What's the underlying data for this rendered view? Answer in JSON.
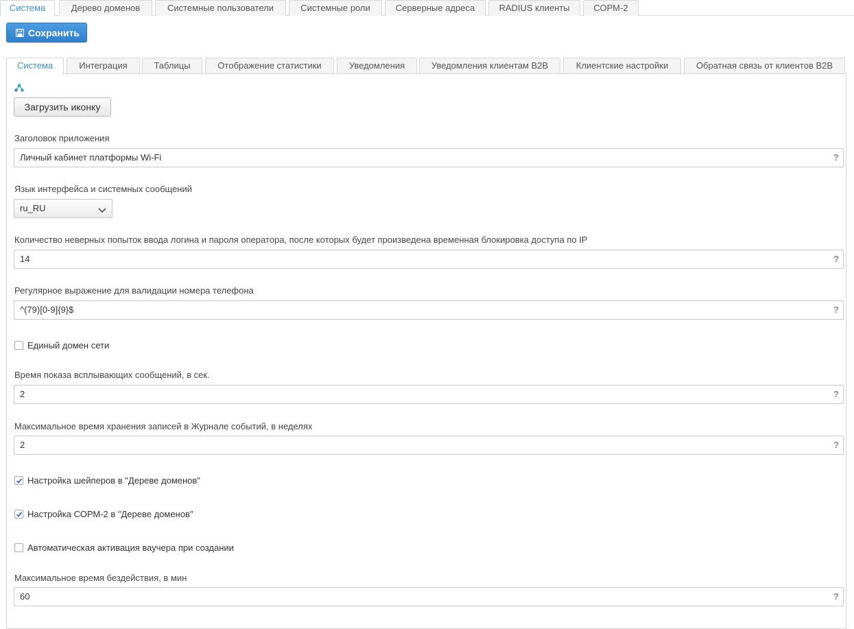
{
  "top_tabs": [
    {
      "label": "Система",
      "active": true
    },
    {
      "label": "Дерево доменов",
      "active": false
    },
    {
      "label": "Системные пользователи",
      "active": false
    },
    {
      "label": "Системные роли",
      "active": false
    },
    {
      "label": "Серверные адреса",
      "active": false
    },
    {
      "label": "RADIUS клиенты",
      "active": false
    },
    {
      "label": "СОРМ-2",
      "active": false
    }
  ],
  "toolbar": {
    "save_label": "Сохранить",
    "save_icon": "floppy-disk-icon"
  },
  "sub_tabs": [
    {
      "label": "Система",
      "active": true
    },
    {
      "label": "Интеграция",
      "active": false
    },
    {
      "label": "Таблицы",
      "active": false
    },
    {
      "label": "Отображение статистики",
      "active": false
    },
    {
      "label": "Уведомления",
      "active": false
    },
    {
      "label": "Уведомления клиентам B2B",
      "active": false
    },
    {
      "label": "Клиентские настройки",
      "active": false
    },
    {
      "label": "Обратная связь от клиентов B2B",
      "active": false
    }
  ],
  "form": {
    "logo_icon": "app-logo-icon",
    "upload_label": "Загрузить иконку",
    "app_title": {
      "label": "Заголовок приложения",
      "value": "Личный кабинет платформы Wi-Fi"
    },
    "language": {
      "label": "Язык интерфейса и системных сообщений",
      "value": "ru_RU"
    },
    "login_attempts": {
      "label": "Количество неверных попыток ввода логина и пароля оператора, после которых будет произведена временная блокировка доступа по IP",
      "value": "14"
    },
    "phone_regex": {
      "label": "Регулярное выражение для валидации номера телефона",
      "value": "^(79)[0-9]{9}$"
    },
    "single_domain": {
      "label": "Единый домен сети",
      "checked": false
    },
    "popup_time": {
      "label": "Время показа всплывающих сообщений, в сек.",
      "value": "2"
    },
    "journal_retention": {
      "label": "Максимальное время хранения записей в Журнале событий, в неделях",
      "value": "2"
    },
    "shapers": {
      "label": "Настройка шейперов в \"Дереве доменов\"",
      "checked": true
    },
    "sorm": {
      "label": "Настройка СОРМ-2 в \"Дереве доменов\"",
      "checked": true
    },
    "voucher": {
      "label": "Автоматическая активация ваучера при создании",
      "checked": false
    },
    "idle_time": {
      "label": "Максимальное время бездействия, в мин",
      "value": "60"
    },
    "help_symbol": "?"
  },
  "colors": {
    "accent": "#3b8fd0",
    "save_button": "#2f7fcb"
  }
}
